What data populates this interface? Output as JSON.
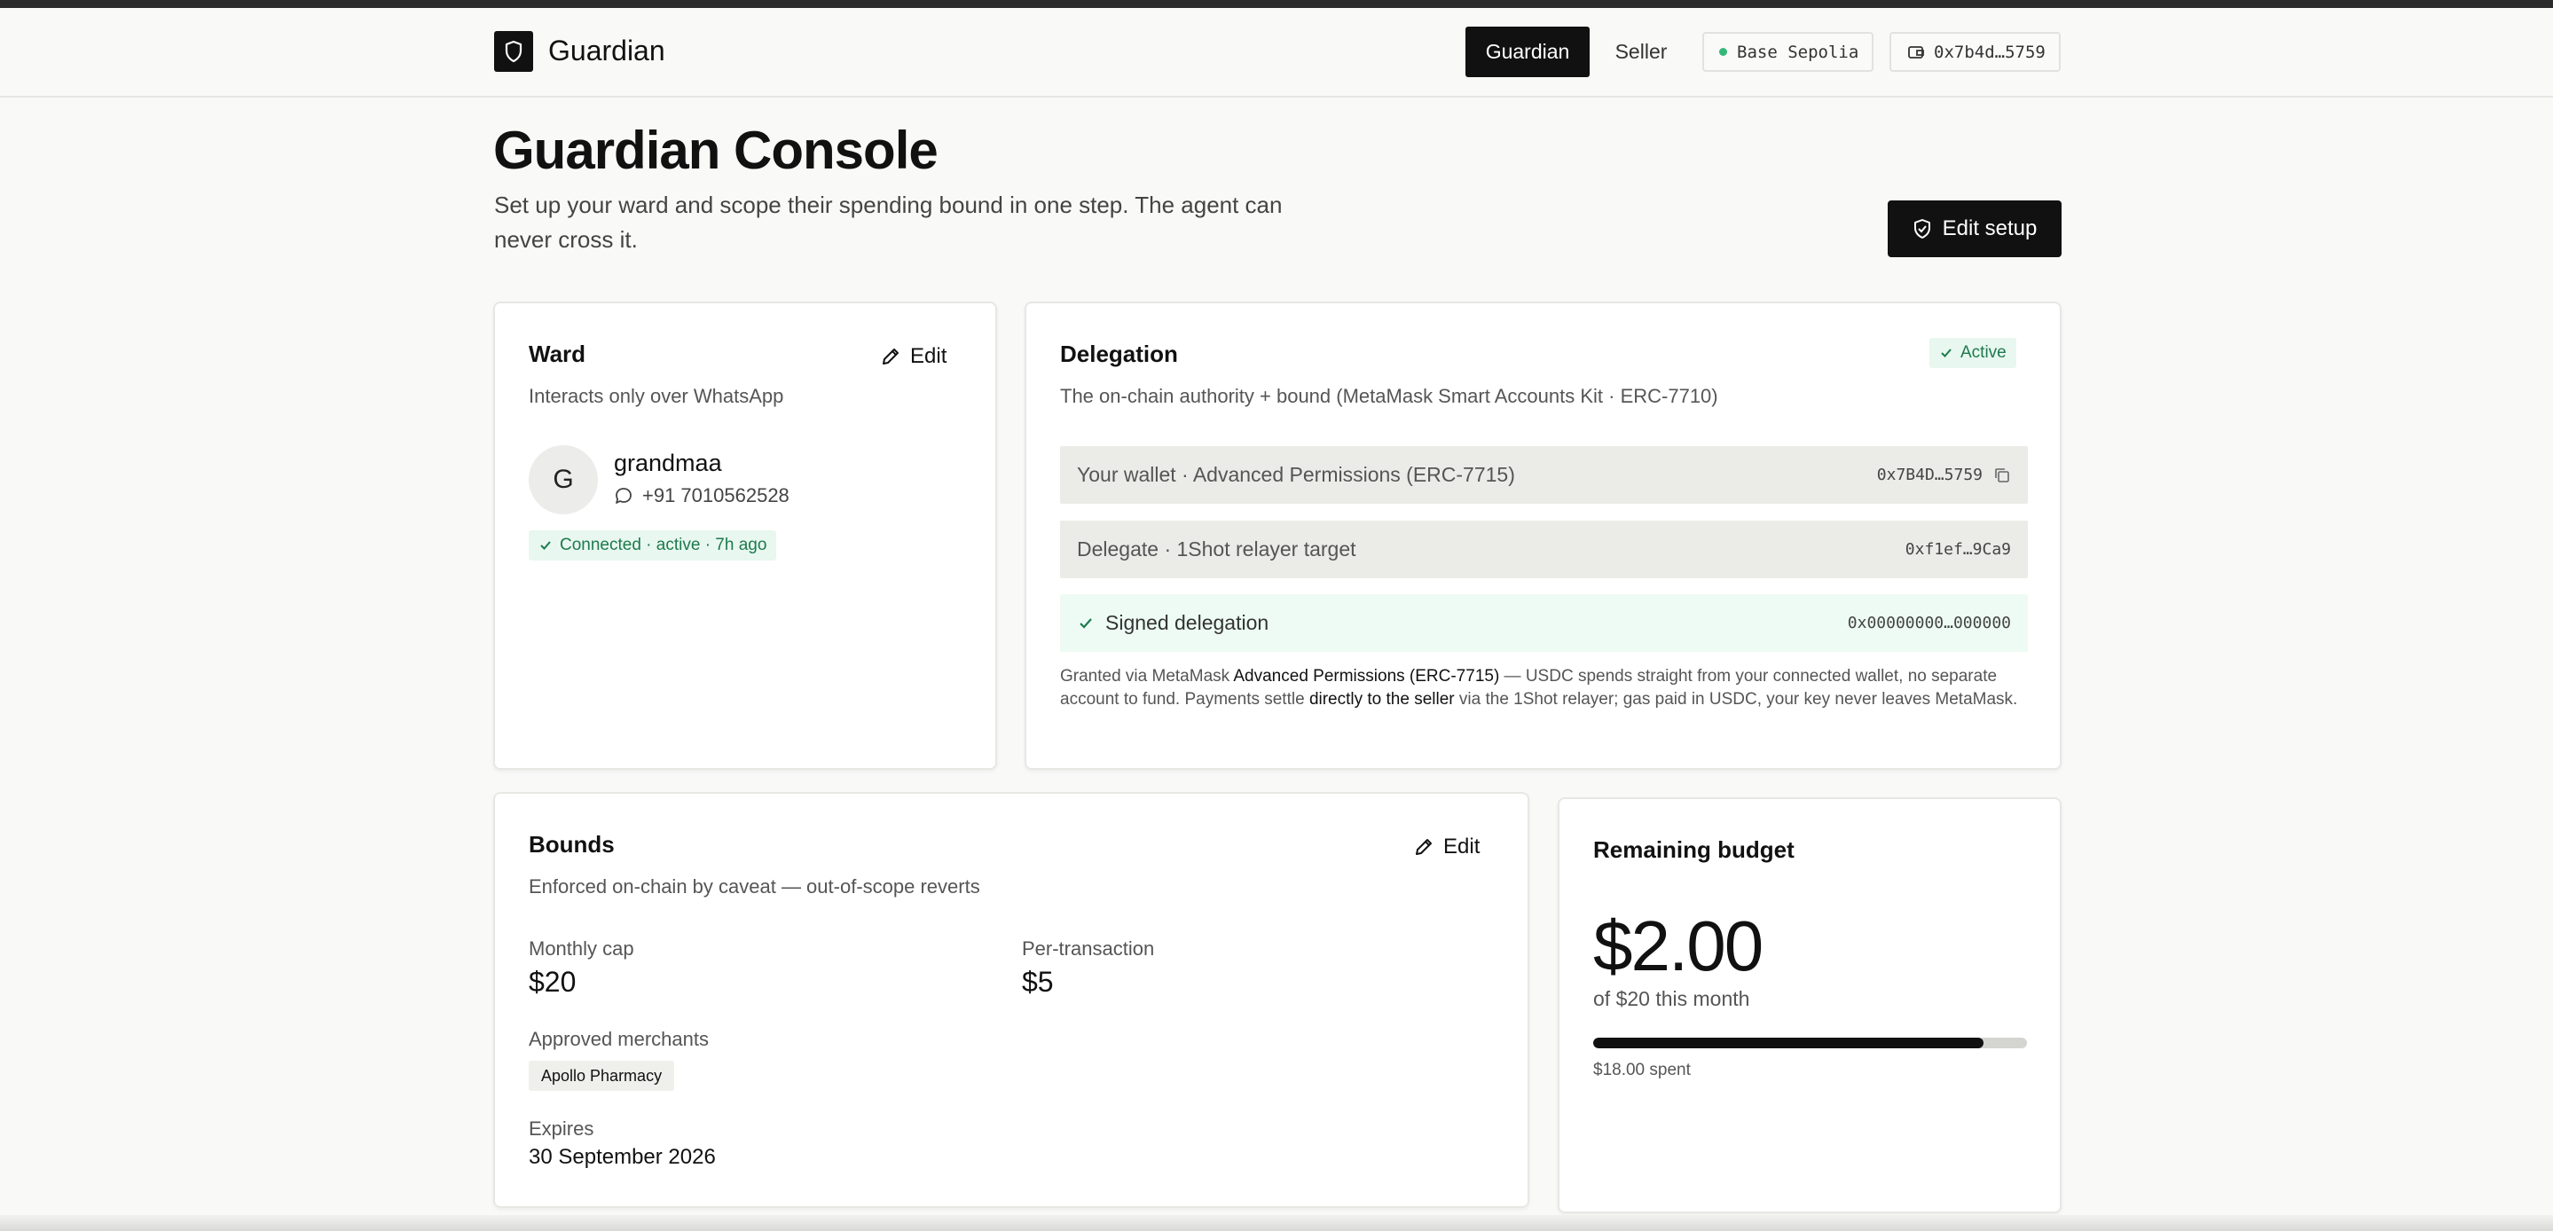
{
  "header": {
    "brand": "Guardian",
    "nav": {
      "guardian": "Guardian",
      "seller": "Seller"
    },
    "network": "Base Sepolia",
    "wallet": "0x7b4d…5759"
  },
  "page": {
    "title": "Guardian Console",
    "subtitle": "Set up your ward and scope their spending bound in one step. The agent can never cross it.",
    "edit_setup": "Edit setup"
  },
  "ward": {
    "title": "Ward",
    "edit": "Edit",
    "subtitle": "Interacts only over WhatsApp",
    "avatar_letter": "G",
    "name": "grandmaa",
    "phone": "+91 7010562528",
    "status": "Connected · active · 7h ago"
  },
  "delegation": {
    "title": "Delegation",
    "status": "Active",
    "subtitle": "The on-chain authority + bound (MetaMask Smart Accounts Kit · ERC-7710)",
    "rows": [
      {
        "label": "Your wallet · Advanced Permissions (ERC-7715)",
        "value": "0x7B4D…5759"
      },
      {
        "label": "Delegate · 1Shot relayer target",
        "value": "0xf1ef…9Ca9"
      },
      {
        "label": "Signed delegation",
        "value": "0x00000000…000000"
      }
    ],
    "note": {
      "p1": "Granted via MetaMask ",
      "b1": "Advanced Permissions (ERC-7715)",
      "p2": " — USDC spends straight from your connected wallet, no separate account to fund. Payments settle ",
      "b2": "directly to the seller",
      "p3": " via the 1Shot relayer; gas paid in USDC, your key never leaves MetaMask."
    }
  },
  "bounds": {
    "title": "Bounds",
    "edit": "Edit",
    "subtitle": "Enforced on-chain by caveat — out-of-scope reverts",
    "monthly_cap_label": "Monthly cap",
    "monthly_cap": "$20",
    "per_tx_label": "Per-transaction",
    "per_tx": "$5",
    "merchants_label": "Approved merchants",
    "merchants": [
      "Apollo Pharmacy"
    ],
    "expires_label": "Expires",
    "expires": "30 September 2026"
  },
  "budget": {
    "title": "Remaining budget",
    "amount": "$2.00",
    "of": "of $20 this month",
    "spent": "$18.00 spent",
    "spent_fraction": 0.9
  },
  "colors": {
    "accent": "#111111",
    "success_bg": "#e8f7ef",
    "success_text": "#1d7a4d",
    "network_dot": "#34b87a"
  },
  "icons": {
    "logo": "shield-icon",
    "wallet": "wallet-icon",
    "edit": "pencil-icon",
    "chat": "chat-bubble-icon",
    "check": "check-icon",
    "copy": "copy-icon"
  }
}
